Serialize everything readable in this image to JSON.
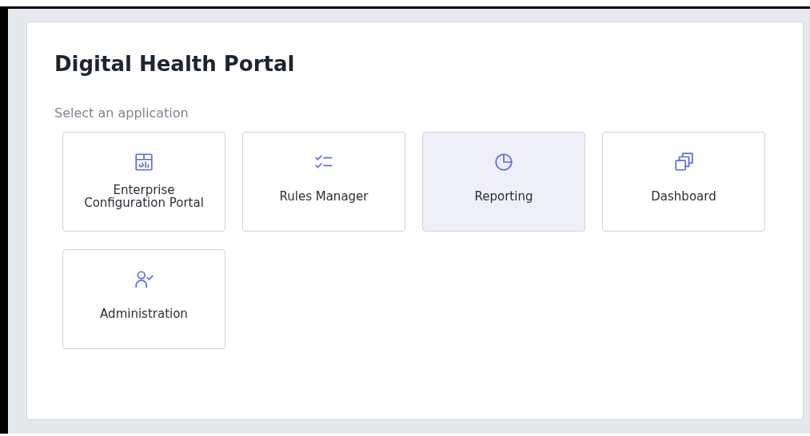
{
  "title": "Digital Health Portal",
  "subtitle": "Select an application",
  "applications": [
    {
      "label": "Enterprise Configuration Portal",
      "selected": false
    },
    {
      "label": "Rules Manager",
      "selected": false
    },
    {
      "label": "Reporting",
      "selected": true
    },
    {
      "label": "Dashboard",
      "selected": false
    },
    {
      "label": "Administration",
      "selected": false
    }
  ]
}
